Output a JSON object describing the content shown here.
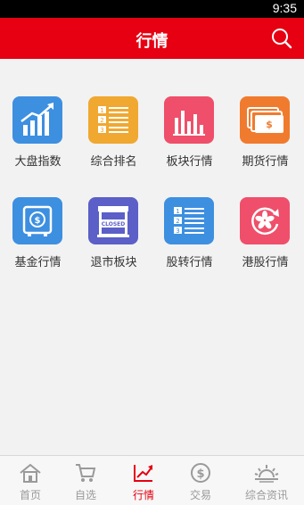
{
  "status": {
    "time": "9:35"
  },
  "header": {
    "title": "行情"
  },
  "tiles": [
    {
      "label": "大盘指数",
      "icon": "chart-trend-up-icon",
      "color": "#3d8fe0"
    },
    {
      "label": "综合排名",
      "icon": "ranked-list-icon",
      "color": "#f0a830"
    },
    {
      "label": "板块行情",
      "icon": "bar-chart-icon",
      "color": "#ef4f6a"
    },
    {
      "label": "期货行情",
      "icon": "cash-stack-icon",
      "color": "#f07b2e"
    },
    {
      "label": "基金行情",
      "icon": "safe-icon",
      "color": "#3d8fe0"
    },
    {
      "label": "退市板块",
      "icon": "closed-store-icon",
      "color": "#5b5fc7",
      "text": "CLOSED"
    },
    {
      "label": "股转行情",
      "icon": "ranked-list-icon",
      "color": "#3d8fe0"
    },
    {
      "label": "港股行情",
      "icon": "bauhinia-icon",
      "color": "#ef4f6a"
    }
  ],
  "tabs": [
    {
      "label": "首页",
      "icon": "home-icon",
      "active": false
    },
    {
      "label": "自选",
      "icon": "cart-icon",
      "active": false
    },
    {
      "label": "行情",
      "icon": "trend-icon",
      "active": true
    },
    {
      "label": "交易",
      "icon": "dollar-coin-icon",
      "active": false
    },
    {
      "label": "综合资讯",
      "icon": "sunrise-icon",
      "active": false
    }
  ],
  "colors": {
    "brand": "#e60012",
    "inactive": "#9a9a9a"
  }
}
